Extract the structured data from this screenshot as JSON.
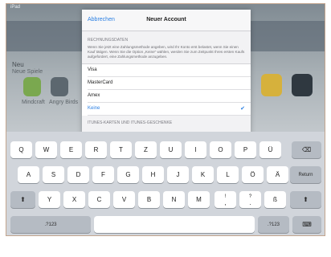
{
  "status_bar": {
    "left": "iPad",
    "right": ""
  },
  "background_store": {
    "heading": "Neu",
    "section_label": "Neue Spiele",
    "app_tiles": [
      "Mindcraft",
      "Angry Birds"
    ]
  },
  "sheet": {
    "cancel_label": "Abbrechen",
    "title": "Neuer Account",
    "billing_header": "RECHNUNGSDATEN",
    "billing_description": "Wenn Sie jetzt eine Zahlungsmethode angeben, wird Ihr Konto erst belastet, wenn Sie einen Kauf tätigen. Wenn Sie die Option „Keine“ wählen, werden Sie zum Zeitpunkt Ihres ersten Kaufs aufgefordert, eine Zahlungsmethode anzugeben.",
    "payment_options": [
      {
        "label": "Visa",
        "selected": false
      },
      {
        "label": "MasterCard",
        "selected": false
      },
      {
        "label": "Amex",
        "selected": false
      },
      {
        "label": "Keine",
        "selected": true
      }
    ],
    "gift_header": "ITUNES-KARTEN UND ITUNES-GESCHENKE"
  },
  "keyboard": {
    "row1": [
      "Q",
      "W",
      "E",
      "R",
      "T",
      "Z",
      "U",
      "I",
      "O",
      "P",
      "Ü"
    ],
    "row2": [
      "A",
      "S",
      "D",
      "F",
      "G",
      "H",
      "J",
      "K",
      "L",
      "Ö",
      "Ä"
    ],
    "row3": [
      "Y",
      "X",
      "C",
      "V",
      "B",
      "N",
      "M"
    ],
    "return_label": "Return",
    "numbers_label": ".?123",
    "excl_top": "!",
    "excl_bottom": ",",
    "question_top": "?",
    "question_bottom": ".",
    "eszett": "ß",
    "shift_glyph": "⬆",
    "delete_glyph": "⌫",
    "keyboard_glyph": "⌨"
  },
  "colors": {
    "accent": "#2a7fe3",
    "keyboard_bg": "#d1d5db",
    "function_key": "#b5bbc3"
  }
}
